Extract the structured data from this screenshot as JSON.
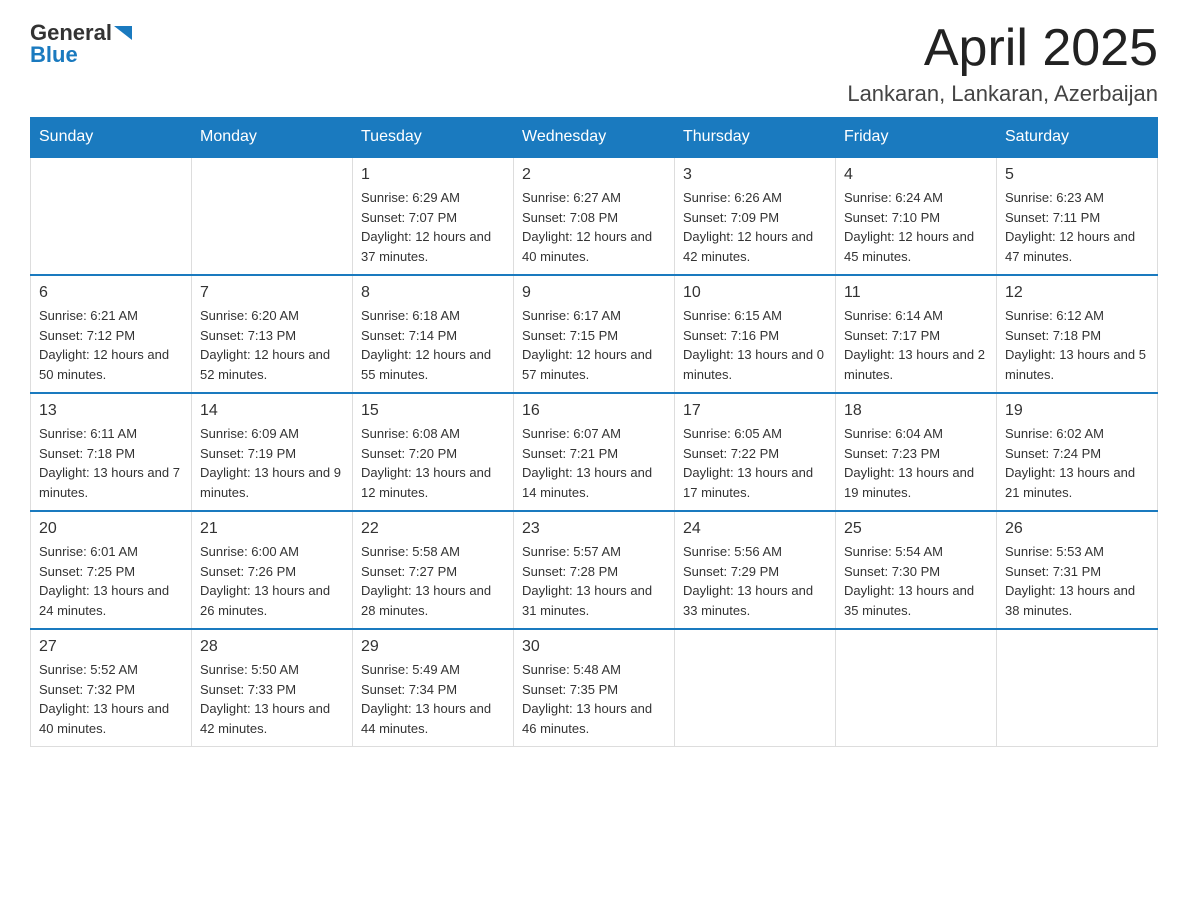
{
  "header": {
    "logo_general": "General",
    "logo_blue": "Blue",
    "month_year": "April 2025",
    "location": "Lankaran, Lankaran, Azerbaijan"
  },
  "weekdays": [
    "Sunday",
    "Monday",
    "Tuesday",
    "Wednesday",
    "Thursday",
    "Friday",
    "Saturday"
  ],
  "weeks": [
    [
      {
        "day": "",
        "sunrise": "",
        "sunset": "",
        "daylight": ""
      },
      {
        "day": "",
        "sunrise": "",
        "sunset": "",
        "daylight": ""
      },
      {
        "day": "1",
        "sunrise": "Sunrise: 6:29 AM",
        "sunset": "Sunset: 7:07 PM",
        "daylight": "Daylight: 12 hours and 37 minutes."
      },
      {
        "day": "2",
        "sunrise": "Sunrise: 6:27 AM",
        "sunset": "Sunset: 7:08 PM",
        "daylight": "Daylight: 12 hours and 40 minutes."
      },
      {
        "day": "3",
        "sunrise": "Sunrise: 6:26 AM",
        "sunset": "Sunset: 7:09 PM",
        "daylight": "Daylight: 12 hours and 42 minutes."
      },
      {
        "day": "4",
        "sunrise": "Sunrise: 6:24 AM",
        "sunset": "Sunset: 7:10 PM",
        "daylight": "Daylight: 12 hours and 45 minutes."
      },
      {
        "day": "5",
        "sunrise": "Sunrise: 6:23 AM",
        "sunset": "Sunset: 7:11 PM",
        "daylight": "Daylight: 12 hours and 47 minutes."
      }
    ],
    [
      {
        "day": "6",
        "sunrise": "Sunrise: 6:21 AM",
        "sunset": "Sunset: 7:12 PM",
        "daylight": "Daylight: 12 hours and 50 minutes."
      },
      {
        "day": "7",
        "sunrise": "Sunrise: 6:20 AM",
        "sunset": "Sunset: 7:13 PM",
        "daylight": "Daylight: 12 hours and 52 minutes."
      },
      {
        "day": "8",
        "sunrise": "Sunrise: 6:18 AM",
        "sunset": "Sunset: 7:14 PM",
        "daylight": "Daylight: 12 hours and 55 minutes."
      },
      {
        "day": "9",
        "sunrise": "Sunrise: 6:17 AM",
        "sunset": "Sunset: 7:15 PM",
        "daylight": "Daylight: 12 hours and 57 minutes."
      },
      {
        "day": "10",
        "sunrise": "Sunrise: 6:15 AM",
        "sunset": "Sunset: 7:16 PM",
        "daylight": "Daylight: 13 hours and 0 minutes."
      },
      {
        "day": "11",
        "sunrise": "Sunrise: 6:14 AM",
        "sunset": "Sunset: 7:17 PM",
        "daylight": "Daylight: 13 hours and 2 minutes."
      },
      {
        "day": "12",
        "sunrise": "Sunrise: 6:12 AM",
        "sunset": "Sunset: 7:18 PM",
        "daylight": "Daylight: 13 hours and 5 minutes."
      }
    ],
    [
      {
        "day": "13",
        "sunrise": "Sunrise: 6:11 AM",
        "sunset": "Sunset: 7:18 PM",
        "daylight": "Daylight: 13 hours and 7 minutes."
      },
      {
        "day": "14",
        "sunrise": "Sunrise: 6:09 AM",
        "sunset": "Sunset: 7:19 PM",
        "daylight": "Daylight: 13 hours and 9 minutes."
      },
      {
        "day": "15",
        "sunrise": "Sunrise: 6:08 AM",
        "sunset": "Sunset: 7:20 PM",
        "daylight": "Daylight: 13 hours and 12 minutes."
      },
      {
        "day": "16",
        "sunrise": "Sunrise: 6:07 AM",
        "sunset": "Sunset: 7:21 PM",
        "daylight": "Daylight: 13 hours and 14 minutes."
      },
      {
        "day": "17",
        "sunrise": "Sunrise: 6:05 AM",
        "sunset": "Sunset: 7:22 PM",
        "daylight": "Daylight: 13 hours and 17 minutes."
      },
      {
        "day": "18",
        "sunrise": "Sunrise: 6:04 AM",
        "sunset": "Sunset: 7:23 PM",
        "daylight": "Daylight: 13 hours and 19 minutes."
      },
      {
        "day": "19",
        "sunrise": "Sunrise: 6:02 AM",
        "sunset": "Sunset: 7:24 PM",
        "daylight": "Daylight: 13 hours and 21 minutes."
      }
    ],
    [
      {
        "day": "20",
        "sunrise": "Sunrise: 6:01 AM",
        "sunset": "Sunset: 7:25 PM",
        "daylight": "Daylight: 13 hours and 24 minutes."
      },
      {
        "day": "21",
        "sunrise": "Sunrise: 6:00 AM",
        "sunset": "Sunset: 7:26 PM",
        "daylight": "Daylight: 13 hours and 26 minutes."
      },
      {
        "day": "22",
        "sunrise": "Sunrise: 5:58 AM",
        "sunset": "Sunset: 7:27 PM",
        "daylight": "Daylight: 13 hours and 28 minutes."
      },
      {
        "day": "23",
        "sunrise": "Sunrise: 5:57 AM",
        "sunset": "Sunset: 7:28 PM",
        "daylight": "Daylight: 13 hours and 31 minutes."
      },
      {
        "day": "24",
        "sunrise": "Sunrise: 5:56 AM",
        "sunset": "Sunset: 7:29 PM",
        "daylight": "Daylight: 13 hours and 33 minutes."
      },
      {
        "day": "25",
        "sunrise": "Sunrise: 5:54 AM",
        "sunset": "Sunset: 7:30 PM",
        "daylight": "Daylight: 13 hours and 35 minutes."
      },
      {
        "day": "26",
        "sunrise": "Sunrise: 5:53 AM",
        "sunset": "Sunset: 7:31 PM",
        "daylight": "Daylight: 13 hours and 38 minutes."
      }
    ],
    [
      {
        "day": "27",
        "sunrise": "Sunrise: 5:52 AM",
        "sunset": "Sunset: 7:32 PM",
        "daylight": "Daylight: 13 hours and 40 minutes."
      },
      {
        "day": "28",
        "sunrise": "Sunrise: 5:50 AM",
        "sunset": "Sunset: 7:33 PM",
        "daylight": "Daylight: 13 hours and 42 minutes."
      },
      {
        "day": "29",
        "sunrise": "Sunrise: 5:49 AM",
        "sunset": "Sunset: 7:34 PM",
        "daylight": "Daylight: 13 hours and 44 minutes."
      },
      {
        "day": "30",
        "sunrise": "Sunrise: 5:48 AM",
        "sunset": "Sunset: 7:35 PM",
        "daylight": "Daylight: 13 hours and 46 minutes."
      },
      {
        "day": "",
        "sunrise": "",
        "sunset": "",
        "daylight": ""
      },
      {
        "day": "",
        "sunrise": "",
        "sunset": "",
        "daylight": ""
      },
      {
        "day": "",
        "sunrise": "",
        "sunset": "",
        "daylight": ""
      }
    ]
  ]
}
